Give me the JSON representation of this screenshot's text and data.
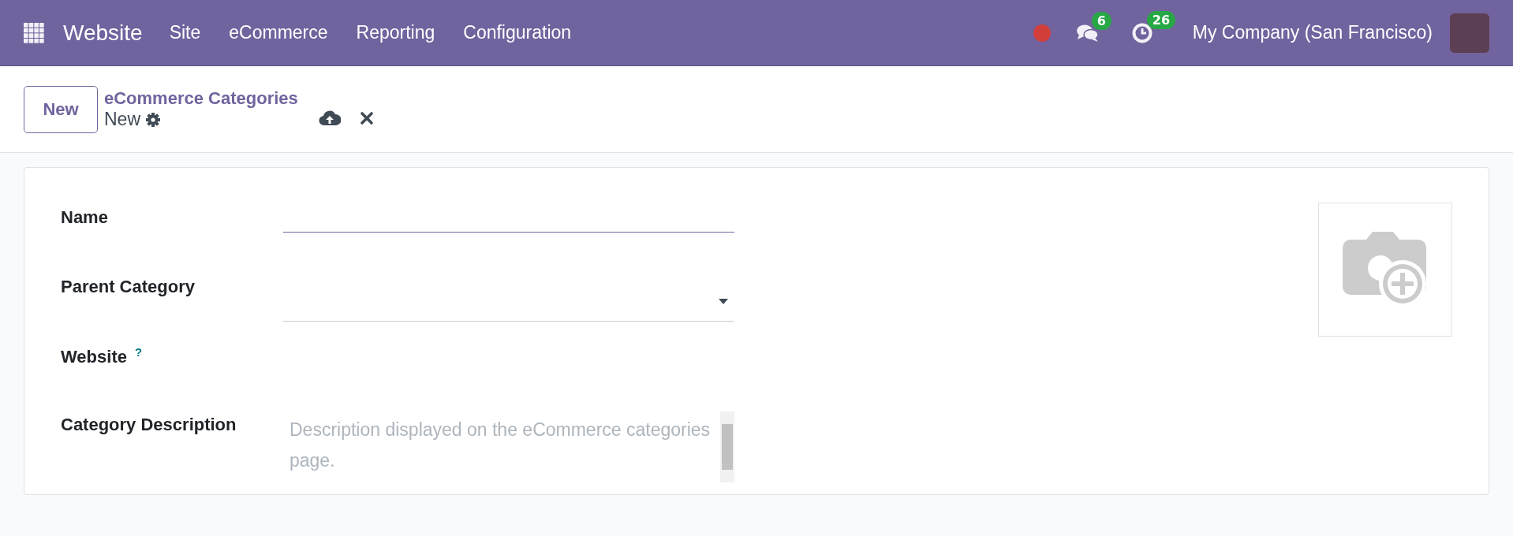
{
  "navbar": {
    "app_name": "Website",
    "menu": [
      "Site",
      "eCommerce",
      "Reporting",
      "Configuration"
    ],
    "messages_count": "6",
    "activities_count": "26",
    "company": "My Company (San Francisco)"
  },
  "control_panel": {
    "new_button": "New",
    "breadcrumb": "eCommerce Categories",
    "record_title": "New"
  },
  "form": {
    "fields": [
      {
        "kind": "text",
        "label": "Name",
        "focused": true
      },
      {
        "kind": "dropdown",
        "label": "Parent Category",
        "focused": false
      },
      {
        "kind": "empty",
        "label": "Website",
        "help": "?"
      },
      {
        "kind": "textarea",
        "label": "Category Description",
        "placeholder": "Description displayed on the eCommerce categories page."
      }
    ]
  }
}
